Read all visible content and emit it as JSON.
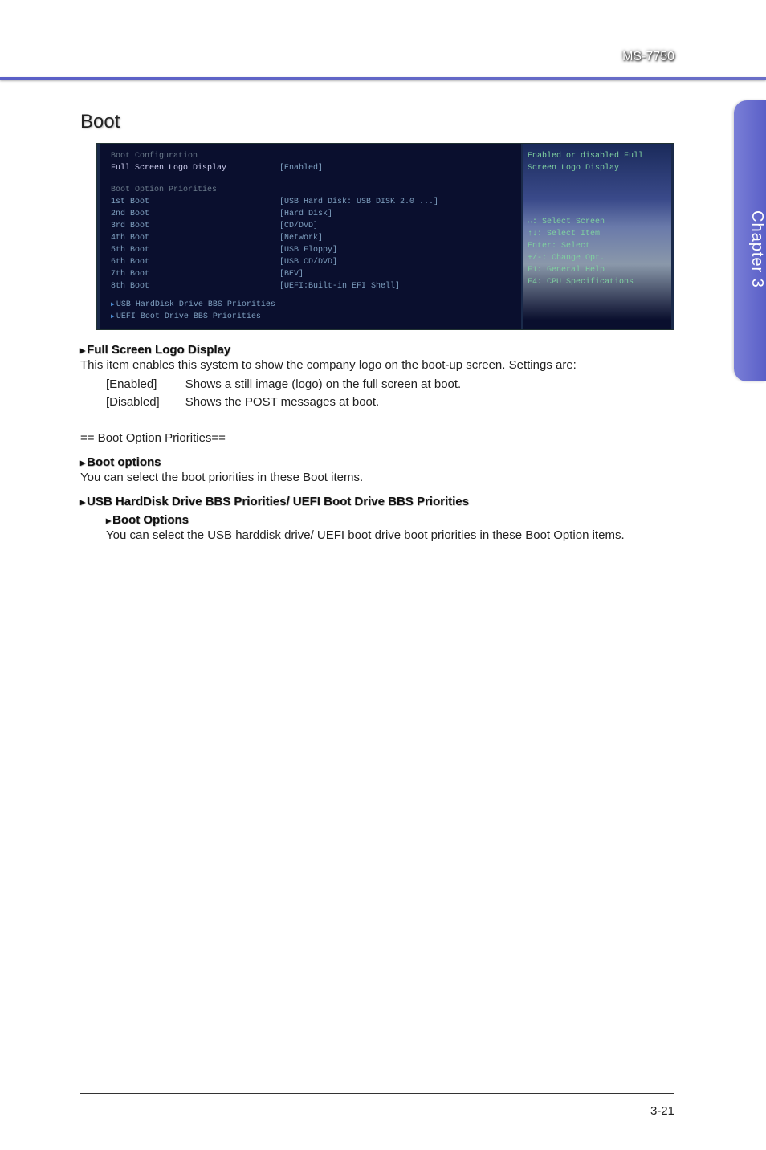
{
  "header": {
    "model": "MS-7750"
  },
  "side_tab": "Chapter 3",
  "section": {
    "title": "Boot"
  },
  "bios": {
    "config_header": "Boot Configuration",
    "full_logo_label": "Full Screen Logo Display",
    "full_logo_value": "[Enabled]",
    "priorities_header": "Boot Option Priorities",
    "boots": [
      {
        "label": "1st Boot",
        "value": "[USB Hard Disk: USB DISK 2.0 ...]"
      },
      {
        "label": "2nd Boot",
        "value": "[Hard Disk]"
      },
      {
        "label": "3rd Boot",
        "value": "[CD/DVD]"
      },
      {
        "label": "4th Boot",
        "value": "[Network]"
      },
      {
        "label": "5th Boot",
        "value": "[USB Floppy]"
      },
      {
        "label": "6th Boot",
        "value": "[USB CD/DVD]"
      },
      {
        "label": "7th Boot",
        "value": "[BEV]"
      },
      {
        "label": "8th Boot",
        "value": "[UEFI:Built-in EFI Shell]"
      }
    ],
    "sub1": "USB HardDisk Drive BBS Priorities",
    "sub2": "UEFI Boot Drive BBS Priorities",
    "help_text": "Enabled or disabled Full Screen Logo Display",
    "keys": {
      "k1": "↔: Select Screen",
      "k2": "↑↓: Select Item",
      "k3": "Enter: Select",
      "k4": "+/-: Change Opt.",
      "k5": "F1: General Help",
      "k6": "F4: CPU Specifications"
    }
  },
  "desc": {
    "fslogo_title": "Full Screen Logo Display",
    "fslogo_body": "This item enables this system to show the company logo on the boot-up screen. Settings are:",
    "opts": {
      "enabled_k": "[Enabled]",
      "enabled_v": "Shows a still image (logo) on the full screen at boot.",
      "disabled_k": "[Disabled]",
      "disabled_v": "Shows the POST messages at boot."
    },
    "priorities_header": "== Boot Option Priorities==",
    "bootopt_title": "Boot options",
    "bootopt_body": "You can select the boot priorities in these Boot items.",
    "bbs_title": "USB HardDisk Drive BBS Priorities/ UEFI Boot Drive BBS Priorities",
    "bbs_sub_title": "Boot Options",
    "bbs_sub_body": "You can select the USB harddisk drive/ UEFI boot drive boot priorities in these Boot Option items."
  },
  "footer": {
    "page": "3-21"
  }
}
